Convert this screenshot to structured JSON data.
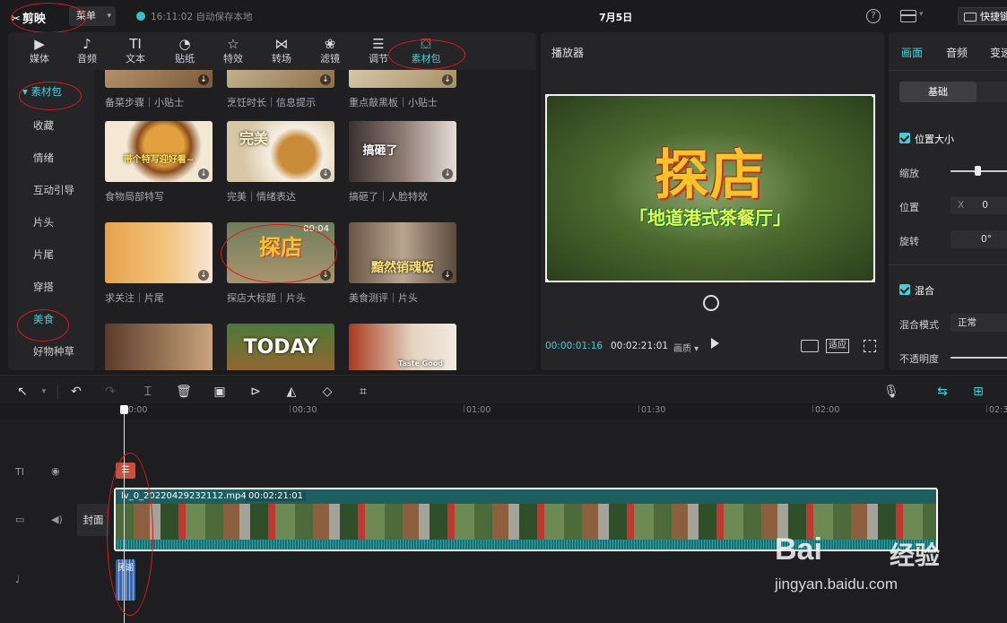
{
  "app": {
    "name": "剪映",
    "menu_label": "菜单",
    "autosave": "16:11:02 自动保存本地",
    "doc_title": "7月5日",
    "shortcut_label": "快捷键"
  },
  "library": {
    "tabs": [
      {
        "label": "媒体",
        "icon": "media-icon"
      },
      {
        "label": "音频",
        "icon": "audio-icon"
      },
      {
        "label": "文本",
        "icon": "text-icon",
        "glyph": "TI"
      },
      {
        "label": "贴纸",
        "icon": "sticker-icon"
      },
      {
        "label": "特效",
        "icon": "effects-icon"
      },
      {
        "label": "转场",
        "icon": "transition-icon"
      },
      {
        "label": "滤镜",
        "icon": "filter-icon"
      },
      {
        "label": "调节",
        "icon": "adjust-icon"
      },
      {
        "label": "素材包",
        "icon": "material-pack-icon"
      }
    ],
    "active_tab": "素材包",
    "categories": [
      "素材包",
      "收藏",
      "情绪",
      "互动引导",
      "片头",
      "片尾",
      "穿搭",
      "美食",
      "好物种草"
    ],
    "selected_categories": [
      "素材包",
      "美食"
    ],
    "cards": [
      {
        "caption": "备菜步骤｜小贴士"
      },
      {
        "caption": "烹饪时长｜信息提示"
      },
      {
        "caption": "重点敲黑板｜小贴士"
      },
      {
        "caption": "食物局部特写",
        "overlay": "带个特写迎好看~"
      },
      {
        "caption": "完美｜情绪表达",
        "overlay": "完美"
      },
      {
        "caption": "搞砸了｜人脸特效",
        "overlay": "搞砸了"
      },
      {
        "caption": "求关注｜片尾"
      },
      {
        "caption": "探店大标题｜片头",
        "overlay": "探店",
        "duration": "00:04"
      },
      {
        "caption": "美食测评｜片头",
        "overlay": "黯然销魂饭"
      },
      {
        "caption": ""
      },
      {
        "caption": "",
        "overlay": "TODAY"
      },
      {
        "caption": "",
        "overlay": "Taste Good"
      }
    ]
  },
  "player": {
    "title": "播放器",
    "video_title": "探店",
    "video_subtitle": "「地道港式茶餐厅」",
    "current_time": "00:00:01:16",
    "total_time": "00:02:21:01",
    "quality": "画质",
    "fit_label": "适应"
  },
  "inspector": {
    "tabs": [
      "画面",
      "音频",
      "变速"
    ],
    "active_tab": "画面",
    "subtab_basic": "基础",
    "position_size": "位置大小",
    "scale": "缩放",
    "position": "位置",
    "x_label": "X",
    "x_value": "0",
    "rotate": "旋转",
    "rotate_value": "0°",
    "blend": "混合",
    "blend_mode": "混合模式",
    "blend_value": "正常",
    "opacity": "不透明度"
  },
  "timeline": {
    "ruler": [
      "00:00",
      "00:30",
      "01:00",
      "01:30",
      "02:00",
      "02:3"
    ],
    "clip_name": "lv_0_20220429232112.mp4",
    "clip_duration": "00:02:21:01",
    "cover_label": "封面",
    "audio_clip_label": "民谣"
  },
  "watermark": {
    "logo": "Bai",
    "logo2": "经验",
    "url": "jingyan.baidu.com"
  },
  "colors": {
    "accent": "#3fd1d8",
    "annotation": "#e01818"
  }
}
